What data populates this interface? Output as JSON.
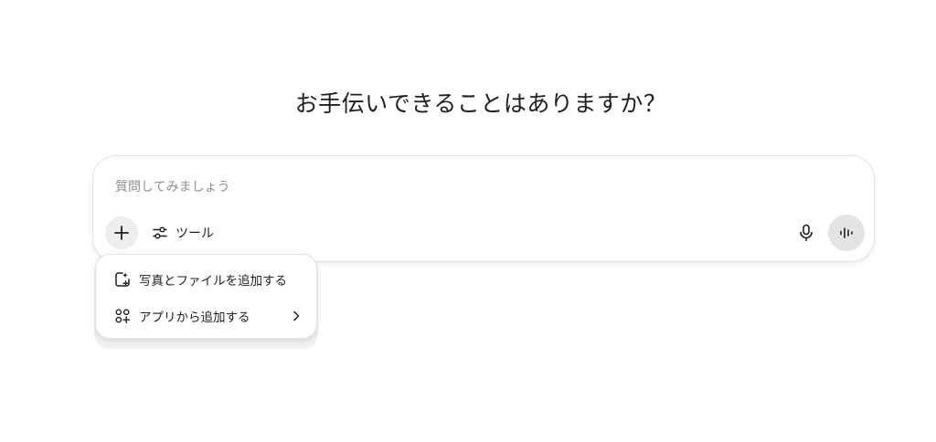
{
  "header": {
    "title": "お手伝いできることはありますか？"
  },
  "composer": {
    "placeholder": "質問してみましょう",
    "value": "",
    "tools_label": "ツール"
  },
  "attach_menu": {
    "items": [
      {
        "label": "写真とファイルを追加する",
        "icon": "photo-add-icon",
        "has_submenu": false
      },
      {
        "label": "アプリから追加する",
        "icon": "apps-add-icon",
        "has_submenu": true
      }
    ]
  },
  "icons": {
    "plus": "plus-icon",
    "tools": "sliders-icon",
    "mic": "mic-icon",
    "voice": "voice-waveform-icon",
    "submenu": "chevron-right-icon"
  },
  "colors": {
    "background": "#ffffff",
    "text": "#1f1f1f",
    "placeholder": "#8e8e8e",
    "button_fill": "#eceef0",
    "voice_fill": "#e4e4e4",
    "border": "#e3e3e3"
  }
}
